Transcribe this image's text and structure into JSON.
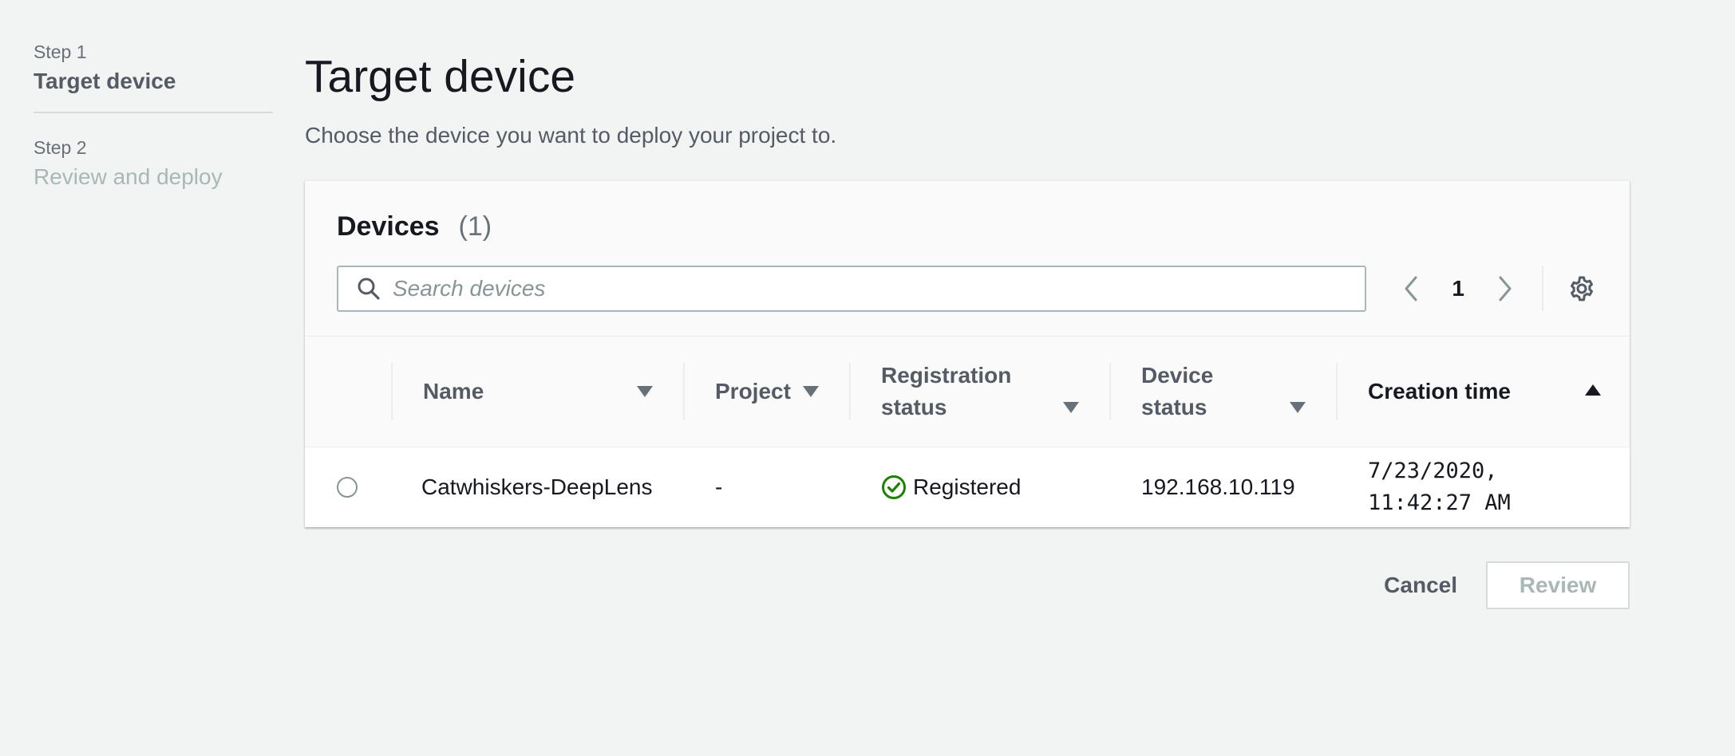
{
  "steps": [
    {
      "label": "Step 1",
      "title": "Target device"
    },
    {
      "label": "Step 2",
      "title": "Review and deploy"
    }
  ],
  "page": {
    "title": "Target device",
    "description": "Choose the device you want to deploy your project to."
  },
  "devices": {
    "title": "Devices",
    "count": "(1)",
    "search_placeholder": "Search devices",
    "current_page": "1",
    "columns": {
      "name": "Name",
      "project": "Project",
      "registration_status_line1": "Registration",
      "registration_status_line2": "status",
      "device_status_line1": "Device",
      "device_status_line2": "status",
      "creation_time": "Creation time"
    },
    "sort": {
      "column": "creation_time",
      "direction": "ascending"
    },
    "rows": [
      {
        "selected": false,
        "name": "Catwhiskers-DeepLens",
        "project": "-",
        "registration_status": "Registered",
        "device_status": "192.168.10.119",
        "creation_time_line1": "7/23/2020,",
        "creation_time_line2": "11:42:27 AM"
      }
    ]
  },
  "actions": {
    "cancel": "Cancel",
    "review": "Review"
  },
  "colors": {
    "background": "#f2f3f3",
    "success": "#1d8102",
    "muted_text": "#687078",
    "disabled_text": "#aab7b8"
  },
  "icons": {
    "search": "search-icon",
    "prev": "chevron-left-icon",
    "next": "chevron-right-icon",
    "settings": "gear-icon",
    "sort_desc": "caret-down-icon",
    "sort_asc": "caret-up-icon",
    "registered": "check-circle-icon"
  }
}
